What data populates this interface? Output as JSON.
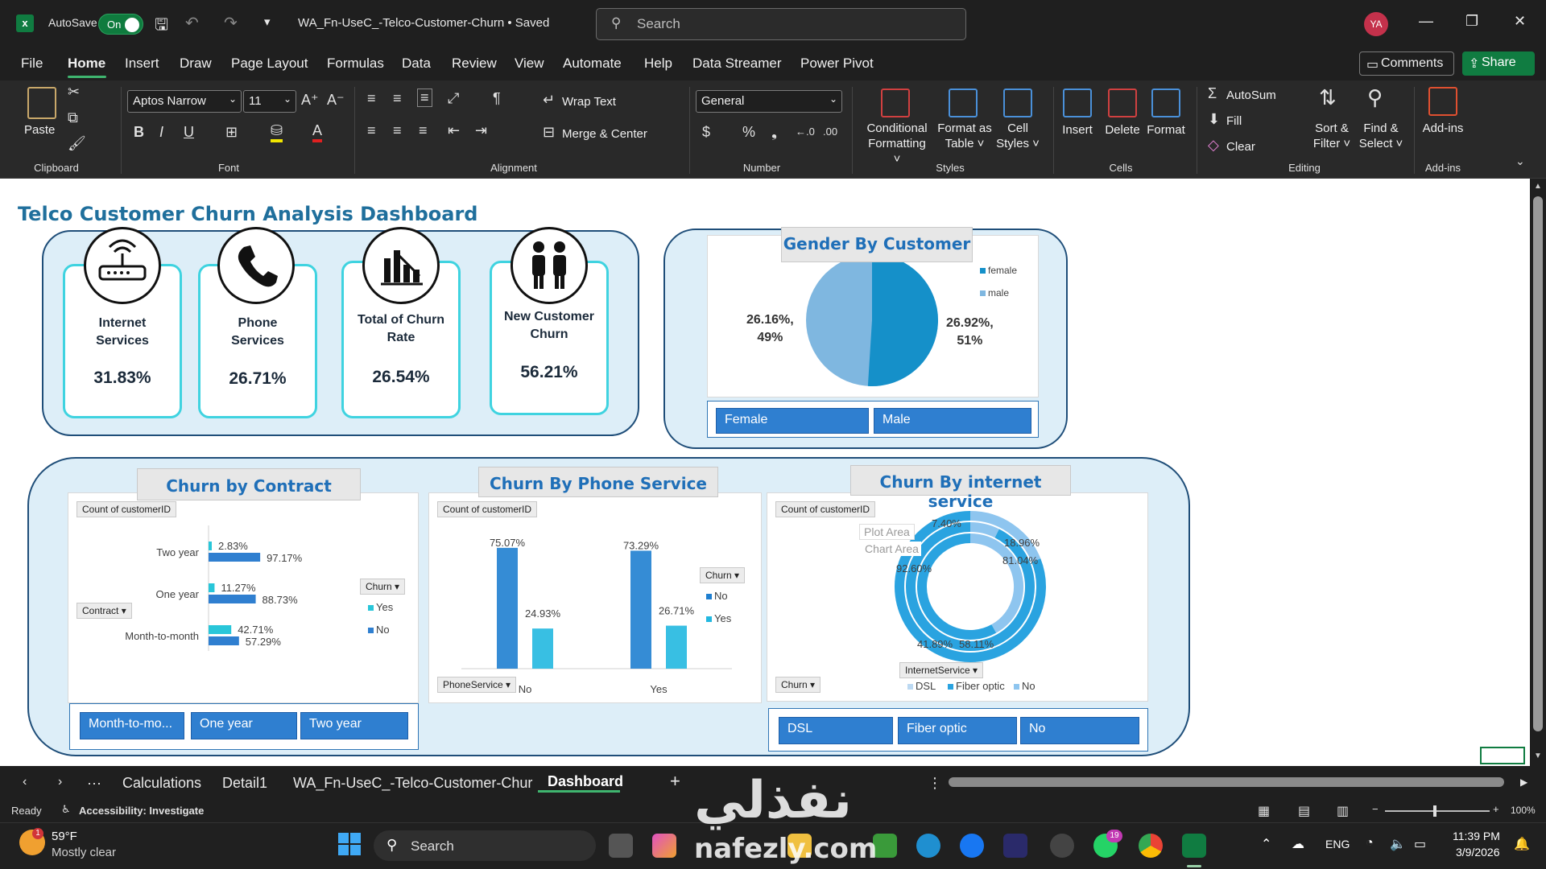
{
  "titlebar": {
    "autosave_label": "AutoSave",
    "autosave_state": "On",
    "filename": "WA_Fn-UseC_-Telco-Customer-Churn • Saved",
    "search_placeholder": "Search",
    "user_initials": "YA"
  },
  "menu": {
    "items": [
      "File",
      "Home",
      "Insert",
      "Draw",
      "Page Layout",
      "Formulas",
      "Data",
      "Review",
      "View",
      "Automate",
      "Help",
      "Data Streamer",
      "Power Pivot"
    ],
    "active": "Home",
    "comments_label": "Comments",
    "share_label": "Share"
  },
  "ribbon": {
    "clipboard": {
      "paste": "Paste",
      "group": "Clipboard"
    },
    "font": {
      "family": "Aptos Narrow",
      "size": "11",
      "group": "Font"
    },
    "alignment": {
      "wrap": "Wrap Text",
      "merge": "Merge & Center",
      "group": "Alignment"
    },
    "number": {
      "format": "General",
      "group": "Number"
    },
    "styles": {
      "conditional": [
        "Conditional",
        "Formatting ˅"
      ],
      "format_table": [
        "Format as",
        "Table ˅"
      ],
      "cell_styles": [
        "Cell",
        "Styles ˅"
      ],
      "group": "Styles"
    },
    "cells": {
      "insert": "Insert",
      "delete": "Delete",
      "format": "Format",
      "group": "Cells"
    },
    "editing": {
      "autosum": "AutoSum",
      "fill": "Fill",
      "clear": "Clear",
      "sort": [
        "Sort &",
        "Filter ˅"
      ],
      "find": [
        "Find &",
        "Select ˅"
      ],
      "group": "Editing"
    },
    "addins": {
      "label": "Add-ins",
      "group": "Add-ins"
    }
  },
  "dashboard": {
    "title": "Telco Customer Churn Analysis Dashboard",
    "kpis": [
      {
        "label1": "Internet",
        "label2": "Services",
        "value": "31.83%",
        "icon": "router-icon"
      },
      {
        "label1": "Phone",
        "label2": "Services",
        "value": "26.71%",
        "icon": "phone-icon"
      },
      {
        "label1": "Total of Churn",
        "label2": "Rate",
        "value": "26.54%",
        "icon": "bar-chart-icon"
      },
      {
        "label1": "New Customer",
        "label2": "Churn",
        "value": "56.21%",
        "icon": "people-icon"
      }
    ],
    "gender": {
      "title": "Gender By Customer",
      "legend": [
        "female",
        "male"
      ],
      "label_left": [
        "26.16%,",
        "49%"
      ],
      "label_right": [
        "26.92%,",
        "51%"
      ],
      "slicer": [
        "Female",
        "Male"
      ]
    },
    "contract": {
      "title": "Churn by Contract",
      "field_count": "Count  of customerID",
      "field_row": "Contract",
      "field_legend": "Churn",
      "legend": [
        "Yes",
        "No"
      ],
      "slicer": [
        "Month-to-mo...",
        "One year",
        "Two year"
      ]
    },
    "phone": {
      "title": "Churn By Phone Service",
      "field_count": "Count  of customerID",
      "field_axis": "PhoneService",
      "field_legend": "Churn",
      "legend": [
        "No",
        "Yes"
      ]
    },
    "internet": {
      "title": "Churn By internet service",
      "field_count": "Count  of customerID",
      "field_churn": "Churn",
      "field_axis": "InternetService",
      "legend": [
        "DSL",
        "Fiber optic",
        "No"
      ],
      "tooltip": [
        "Plot Area",
        "Chart Area"
      ],
      "labels": [
        "7.40%",
        "18.96%",
        "81.04%",
        "92.60%",
        "41.89%",
        "58.11%"
      ],
      "slicer": [
        "DSL",
        "Fiber optic",
        "No"
      ]
    }
  },
  "chart_data": [
    {
      "type": "bar",
      "title": "Churn by Contract",
      "categories": [
        "Two year",
        "One year",
        "Month-to-month"
      ],
      "series": [
        {
          "name": "Yes",
          "values": [
            2.83,
            11.27,
            42.71
          ]
        },
        {
          "name": "No",
          "values": [
            97.17,
            88.73,
            57.29
          ]
        }
      ],
      "orientation": "horizontal",
      "colors": [
        "#29c6d9",
        "#2f7fd0"
      ]
    },
    {
      "type": "bar",
      "title": "Churn By Phone Service",
      "categories": [
        "No",
        "Yes"
      ],
      "series": [
        {
          "name": "No",
          "values": [
            75.07,
            73.29
          ]
        },
        {
          "name": "Yes",
          "values": [
            24.93,
            26.71
          ]
        }
      ],
      "colors": [
        "#1f7fd0",
        "#22b8e0"
      ]
    },
    {
      "type": "pie",
      "title": "Gender By Customer",
      "categories": [
        "female",
        "male"
      ],
      "values": [
        49,
        51
      ],
      "colors": [
        "#1590c9",
        "#7fb7e0"
      ]
    },
    {
      "type": "pie",
      "title": "Churn By internet service",
      "categories": [
        "DSL",
        "Fiber optic",
        "No"
      ],
      "values_outer": [
        18.96,
        81.04
      ],
      "values_middle": [
        7.4,
        92.6
      ],
      "values_inner": [
        41.89,
        58.11
      ],
      "colors": [
        "#8ec5ef",
        "#2aa3e0"
      ]
    }
  ],
  "tabs": {
    "items": [
      "Calculations",
      "Detail1",
      "WA_Fn-UseC_-Telco-Customer-Chur",
      "Dashboard"
    ],
    "active": "Dashboard"
  },
  "status": {
    "ready": "Ready",
    "accessibility": "Accessibility: Investigate",
    "zoom": "100%"
  },
  "taskbar": {
    "temp": "59°F",
    "weather": "Mostly clear",
    "search": "Search",
    "lang": "ENG",
    "time": "11:39 PM",
    "date": "3/9/2026",
    "badge": "19"
  },
  "watermark": {
    "arabic": "نفذلي",
    "latin": "nafezly.com"
  },
  "colors": {
    "excel_green": "#107c41",
    "accent_blue": "#2f7fd0",
    "kpi_border": "#3fd3e0",
    "title_blue": "#1f6f9c"
  }
}
